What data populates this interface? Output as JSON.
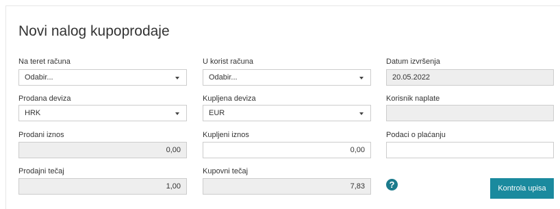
{
  "form": {
    "title": "Novi nalog kupoprodaje",
    "debit_account": {
      "label": "Na teret računa",
      "value": "Odabir..."
    },
    "credit_account": {
      "label": "U korist računa",
      "value": "Odabir..."
    },
    "execution_date": {
      "label": "Datum izvršenja",
      "value": "20.05.2022"
    },
    "sold_currency": {
      "label": "Prodana deviza",
      "value": "HRK"
    },
    "bought_currency": {
      "label": "Kupljena deviza",
      "value": "EUR"
    },
    "payee_user": {
      "label": "Korisnik naplate",
      "value": ""
    },
    "sold_amount": {
      "label": "Prodani iznos",
      "value": "0,00"
    },
    "bought_amount": {
      "label": "Kupljeni iznos",
      "value": "0,00"
    },
    "payment_info": {
      "label": "Podaci o plaćanju",
      "value": ""
    },
    "selling_rate": {
      "label": "Prodajni tečaj",
      "value": "1,00"
    },
    "buying_rate": {
      "label": "Kupovni tečaj",
      "value": "7,83"
    },
    "help_icon": "question-circle-icon",
    "help_glyph": "?",
    "submit_label": "Kontrola upisa"
  },
  "colors": {
    "accent": "#1a8a9e",
    "readonly_bg": "#eeeeee",
    "border": "#cccccc"
  }
}
